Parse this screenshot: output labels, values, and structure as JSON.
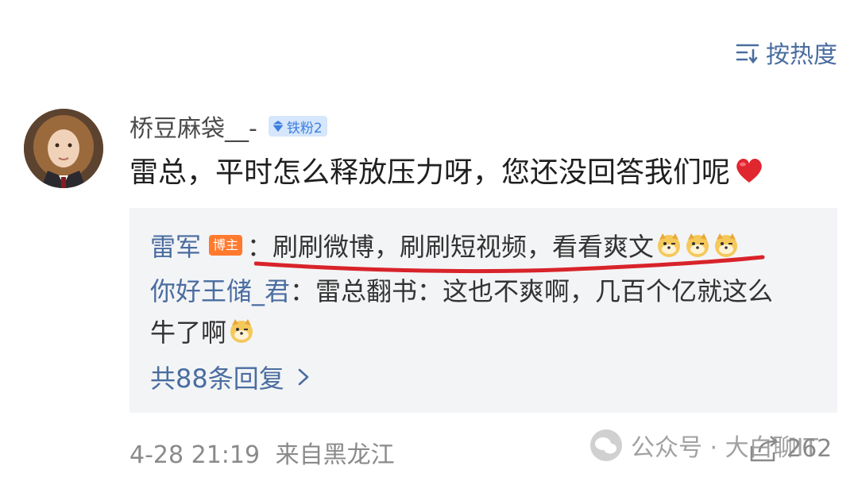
{
  "sort": {
    "label": "按热度",
    "icon": "sort-icon"
  },
  "comment": {
    "avatar": "avatar",
    "username": "桥豆麻袋__-",
    "fan_badge": "铁粉2",
    "text": "雷总，平时怎么释放压力呀，您还没回答我们呢",
    "heart_icon": "heart-icon"
  },
  "replies": [
    {
      "name": "雷军",
      "badge": "博主",
      "text": "：刷刷微博，刷刷短视频，看看爽文",
      "emoji_count": 3
    },
    {
      "name": "你好王储_君",
      "text": "：雷总翻书：这也不爽啊，几百个亿就这么",
      "text_line2": "牛了啊",
      "emoji_count": 1
    }
  ],
  "more_replies": "共88条回复",
  "meta": {
    "timestamp": "4-28 21:19",
    "location": "来自黑龙江"
  },
  "share": {
    "count": "262",
    "icon": "share-icon"
  },
  "watermark": {
    "text": "公众号 · 大白聊IT"
  },
  "colors": {
    "link": "#4a6da0",
    "badge_fan_bg": "#d6e6fb",
    "badge_owner_bg": "#ff7a2e",
    "reply_bg": "#f3f4f6",
    "underline": "#d8232a"
  }
}
